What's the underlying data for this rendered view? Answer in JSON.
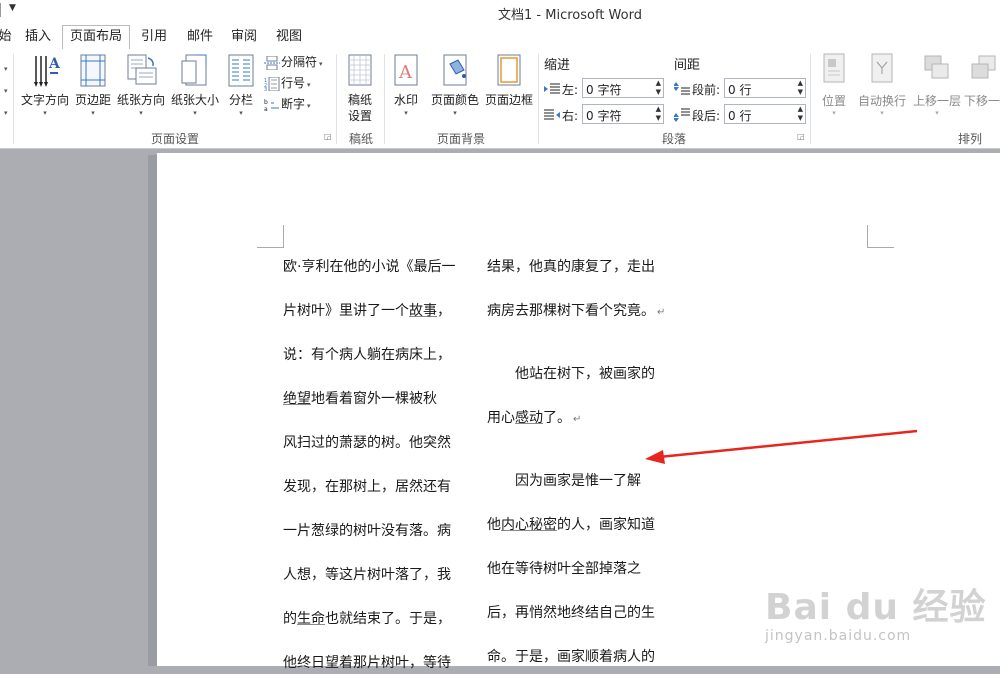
{
  "window": {
    "title": "文档1 - Microsoft Word"
  },
  "tabs": [
    {
      "label": "始"
    },
    {
      "label": "插入"
    },
    {
      "label": "页面布局",
      "active": true
    },
    {
      "label": "引用"
    },
    {
      "label": "邮件"
    },
    {
      "label": "审阅"
    },
    {
      "label": "视图"
    }
  ],
  "ribbon": {
    "page_setup": {
      "label": "页面设置",
      "text_direction": "文字方向",
      "margins": "页边距",
      "orientation": "纸张方向",
      "size": "纸张大小",
      "columns": "分栏",
      "breaks": "分隔符",
      "line_numbers": "行号",
      "hyphenation": "断字"
    },
    "draft_paper": {
      "label": "稿纸",
      "btn_line1": "稿纸",
      "btn_line2": "设置"
    },
    "page_background": {
      "label": "页面背景",
      "watermark": "水印",
      "page_color": "页面颜色",
      "page_borders": "页面边框"
    },
    "paragraph": {
      "label": "段落",
      "indent_title": "缩进",
      "spacing_title": "间距",
      "indent_left_label": "左:",
      "indent_left_value": "0 字符",
      "indent_right_label": "右:",
      "indent_right_value": "0 字符",
      "spacing_before_label": "段前:",
      "spacing_before_value": "0 行",
      "spacing_after_label": "段后:",
      "spacing_after_value": "0 行"
    },
    "arrange": {
      "label": "排列",
      "position": "位置",
      "wrap_text": "自动换行",
      "bring_forward": "上移一层",
      "send_backward": "下移一"
    }
  },
  "document": {
    "left_column": [
      {
        "t": "欧·亨利在他的小说《最后一"
      },
      {
        "t": "片树叶》里讲了一个",
        "u": "故事",
        "after": "，"
      },
      {
        "t": "说：有个病人躺在病床上，"
      },
      {
        "u0": "绝望",
        "t": "地看着窗外一棵被秋"
      },
      {
        "t": "风扫过的萧瑟的树。他突然"
      },
      {
        "t": "发现，在那树上，居然还有"
      },
      {
        "t": "一片葱绿的树叶没有落。病"
      },
      {
        "t": "人想，等这片树叶落了，我"
      },
      {
        "t": "的",
        "u": "生命",
        "after": "也就结束了。于是，"
      },
      {
        "t": "他终日望着那片树叶，等待"
      }
    ],
    "right_column": [
      {
        "t": "结果，他真的康复了，走出"
      },
      {
        "t": "病房去那棵树下看个究竟。",
        "pm": true
      },
      {
        "t": "　　他站在树下，被画家的"
      },
      {
        "t": "用心",
        "u": "感动",
        "after": "了。",
        "pm": true
      },
      {
        "t": "　　因为画家是惟一了解"
      },
      {
        "t": "他",
        "u": "内心秘密",
        "after": "的人，画家知道"
      },
      {
        "t": "他在等待树叶全部掉落之"
      },
      {
        "t": "后，再悄然地终结自己的生"
      },
      {
        "t": "命。于是，画家顺着病人的"
      }
    ],
    "paragraph_mark": "↵"
  },
  "watermark": {
    "logo": "Bai du 经验",
    "url": "jingyan.baidu.com"
  },
  "colors": {
    "arrow": "#e8261f",
    "ribbon_bg": "#ffffff",
    "workspace_bg": "#abadb3"
  }
}
